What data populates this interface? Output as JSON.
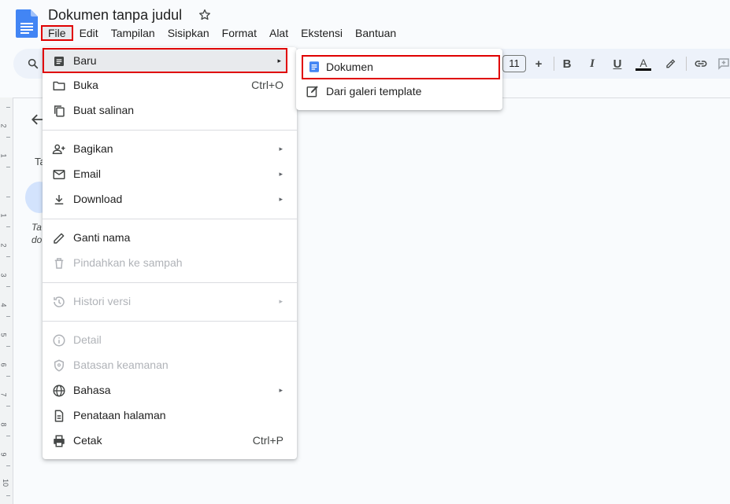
{
  "header": {
    "doc_title": "Dokumen tanpa judul"
  },
  "menubar": {
    "items": [
      "File",
      "Edit",
      "Tampilan",
      "Sisipkan",
      "Format",
      "Alat",
      "Ekstensi",
      "Bantuan"
    ]
  },
  "toolbar": {
    "font_size": "11",
    "plus": "+",
    "bold": "B",
    "italic": "I",
    "underline": "U",
    "text_color": "A",
    "text_color_value": "#000000"
  },
  "outline": {
    "text_1": "Ta",
    "text_2a": "Ta",
    "text_2b": "do"
  },
  "ruler": {
    "numbers": [
      "2",
      "1",
      "1",
      "2",
      "3",
      "4",
      "5",
      "6",
      "7",
      "8",
      "9",
      "10"
    ]
  },
  "file_menu": {
    "items": [
      {
        "label": "Baru",
        "icon": "document-icon",
        "arrow": "▸"
      },
      {
        "label": "Buka",
        "icon": "folder-icon",
        "shortcut": "Ctrl+O"
      },
      {
        "label": "Buat salinan",
        "icon": "copy-icon"
      },
      {
        "label": "Bagikan",
        "icon": "person-add-icon",
        "arrow": "▸"
      },
      {
        "label": "Email",
        "icon": "email-icon",
        "arrow": "▸"
      },
      {
        "label": "Download",
        "icon": "download-icon",
        "arrow": "▸"
      },
      {
        "label": "Ganti nama",
        "icon": "pencil-icon"
      },
      {
        "label": "Pindahkan ke sampah",
        "icon": "trash-icon",
        "disabled": true
      },
      {
        "label": "Histori versi",
        "icon": "history-icon",
        "arrow": "▸",
        "disabled": true
      },
      {
        "label": "Detail",
        "icon": "info-icon",
        "disabled": true
      },
      {
        "label": "Batasan keamanan",
        "icon": "shield-icon",
        "disabled": true
      },
      {
        "label": "Bahasa",
        "icon": "globe-icon",
        "arrow": "▸"
      },
      {
        "label": "Penataan halaman",
        "icon": "page-setup-icon"
      },
      {
        "label": "Cetak",
        "icon": "printer-icon",
        "shortcut": "Ctrl+P"
      }
    ]
  },
  "sub_menu": {
    "items": [
      {
        "label": "Dokumen",
        "icon": "document-blue-icon"
      },
      {
        "label": "Dari galeri template",
        "icon": "template-icon"
      }
    ]
  },
  "colors": {
    "highlight_border": "#e00000",
    "docs_blue": "#4285f4",
    "toolbar_bg": "#edf2fa"
  }
}
